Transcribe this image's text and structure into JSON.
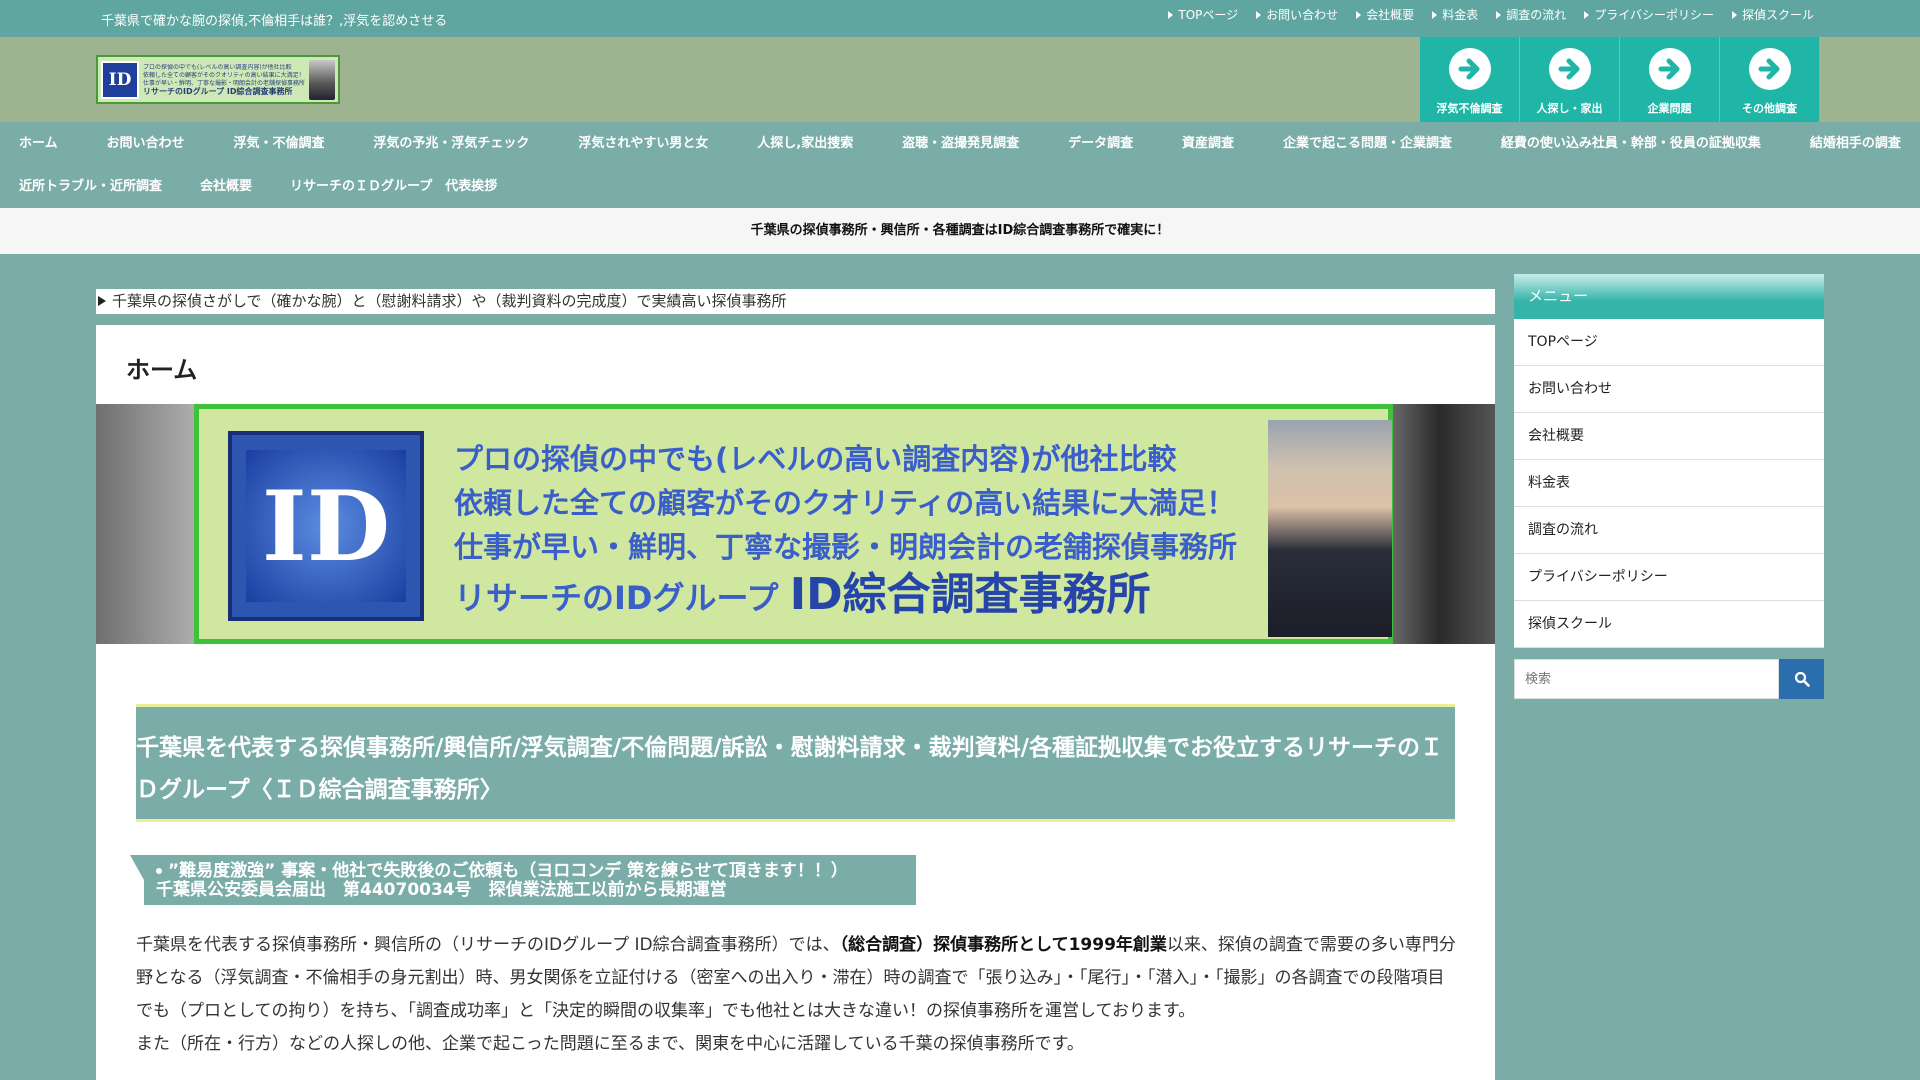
{
  "top": {
    "tagline": "千葉県で確かな腕の探偵,不倫相手は誰？,浮気を認めさせる",
    "links": [
      "TOPページ",
      "お問い合わせ",
      "会社概要",
      "料金表",
      "調査の流れ",
      "プライバシーポリシー",
      "探偵スクール"
    ]
  },
  "logo": {
    "id_text": "ID",
    "lines": [
      "プロの探偵の中でも(レベルの高い調査内容)が他社比較",
      "依頼した全ての顧客がそのクオリティの高い結果に大満足！",
      "仕事が早い・鮮明、丁寧な撮影・明朗会計の老舗探偵事務所",
      "リサーチのIDグループ ID綜合調査事務所"
    ]
  },
  "category_buttons": [
    "浮気不倫調査",
    "人探し・家出",
    "企業問題",
    "その他調査"
  ],
  "nav": {
    "row1": [
      "ホーム",
      "お問い合わせ",
      "浮気・不倫調査",
      "浮気の予兆・浮気チェック",
      "浮気されやすい男と女",
      "人探し,家出捜索",
      "盗聴・盗撮発見調査",
      "データ調査",
      "資産調査",
      "企業で起こる問題・企業調査",
      "経費の使い込み社員・幹部・役員の証拠収集",
      "結婚相手の調査"
    ],
    "row2": [
      "近所トラブル・近所調査",
      "会社概要",
      "リサーチのＩＤグループ　代表挨拶"
    ]
  },
  "announcement": "千葉県の探偵事務所・興信所・各種調査はID綜合調査事務所で確実に！",
  "breadcrumb": "千葉県の探偵さがしで（確かな腕）と（慰謝料請求）や（裁判資料の完成度）で実績高い探偵事務所",
  "page_title": "ホーム",
  "banner": {
    "logo_text": "ID",
    "lines": [
      "プロの探偵の中でも(レベルの高い調査内容)が他社比較",
      "依頼した全ての顧客がそのクオリティの高い結果に大満足！",
      "仕事が早い・鮮明、丁寧な撮影・明朗会計の老舗探偵事務所"
    ],
    "last_prefix": "リサーチのIDグループ ",
    "last_big": "ID綜合調査事務所"
  },
  "heading": "千葉県を代表する探偵事務所/興信所/浮気調査/不倫問題/訴訟・慰謝料請求・裁判資料/各種証拠収集でお役立するリサーチのＩＤグループ〈ＩＤ綜合調査事務所〉",
  "subheading": {
    "line1": "”難易度激強” 事案・他社で失敗後のご依頼も（ヨロコンデ 策を練らせて頂きます！！）",
    "line2": "千葉県公安委員会届出　第44070034号　探偵業法施工以前から長期運営"
  },
  "body": {
    "p1_before": "千葉県を代表する探偵事務所・興信所の（リサーチのIDグループ ID綜合調査事務所）では、",
    "p1_bold": "（総合調査）探偵事務所として1999年創業",
    "p1_after": "以来、探偵の調査で需要の多い専門分野となる（浮気調査・不倫相手の身元割出）時、男女関係を立証付ける（密室への出入り・滞在）時の調査で「張り込み」・「尾行」・「潜入」・「撮影」の各調査での段階項目でも（プロとしての拘り）を持ち、「調査成功率」と「決定的瞬間の収集率」でも他社とは大きな違い！の探偵事務所を運営しております。",
    "p2": "また（所在・行方）などの人探しの他、企業で起こった問題に至るまで、関東を中心に活躍している千葉の探偵事務所です。"
  },
  "sidebar": {
    "title": "メニュー",
    "items": [
      "TOPページ",
      "お問い合わせ",
      "会社概要",
      "料金表",
      "調査の流れ",
      "プライバシーポリシー",
      "探偵スクール"
    ],
    "search_placeholder": "検索"
  }
}
